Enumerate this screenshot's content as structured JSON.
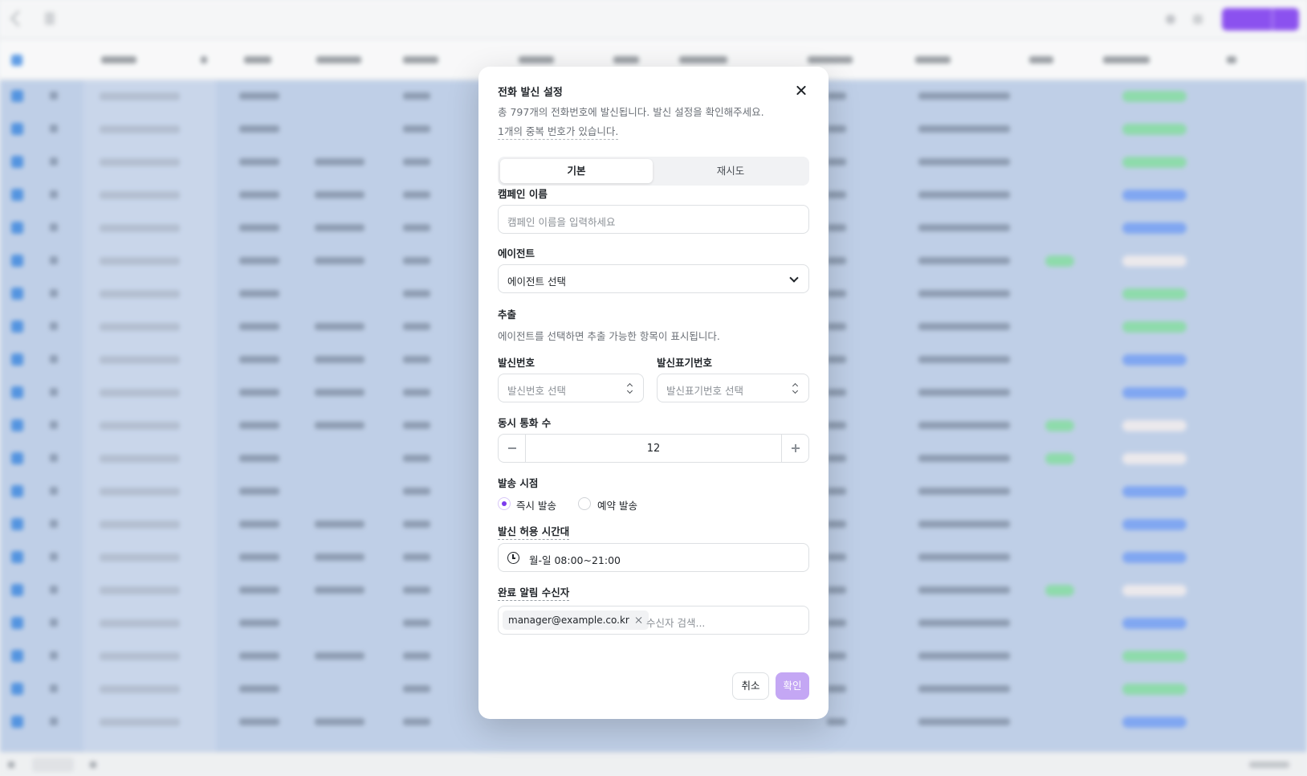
{
  "modal": {
    "title": "전화 발신 설정",
    "description": "총 797개의 전화번호에 발신됩니다. 발신 설정을 확인해주세요.",
    "duplicate_notice": "1개의 중복 번호가 있습니다.",
    "tabs": [
      {
        "label": "기본",
        "active": true
      },
      {
        "label": "재시도",
        "active": false
      }
    ],
    "campaign_name": {
      "label": "캠페인 이름",
      "placeholder": "캠페인 이름을 입력하세요",
      "value": ""
    },
    "agent": {
      "label": "에이전트",
      "selected": "에이전트 선택"
    },
    "extraction": {
      "label": "추출",
      "hint": "에이전트를 선택하면 추출 가능한 항목이 표시됩니다."
    },
    "caller_number": {
      "label": "발신번호",
      "placeholder": "발신번호 선택"
    },
    "caller_display_number": {
      "label": "발신표기번호",
      "placeholder": "발신표기번호 선택"
    },
    "concurrent_calls": {
      "label": "동시 통화 수",
      "value": "12"
    },
    "send_time": {
      "label": "발송 시점",
      "options": [
        {
          "label": "즉시 발송",
          "selected": true
        },
        {
          "label": "예약 발송",
          "selected": false
        }
      ]
    },
    "allowed_hours": {
      "label": "발신 허용 시간대",
      "value": "월-일 08:00~21:00"
    },
    "notify_recipients": {
      "label": "완료 알림 수신자",
      "chips": [
        "manager@example.co.kr"
      ],
      "search_placeholder": "수신자 검색..."
    },
    "buttons": {
      "cancel": "취소",
      "confirm": "확인"
    }
  },
  "colors": {
    "accent": "#7c3aed",
    "confirm_disabled": "#c4a7f4",
    "selection_row": "#b7c9e4"
  }
}
